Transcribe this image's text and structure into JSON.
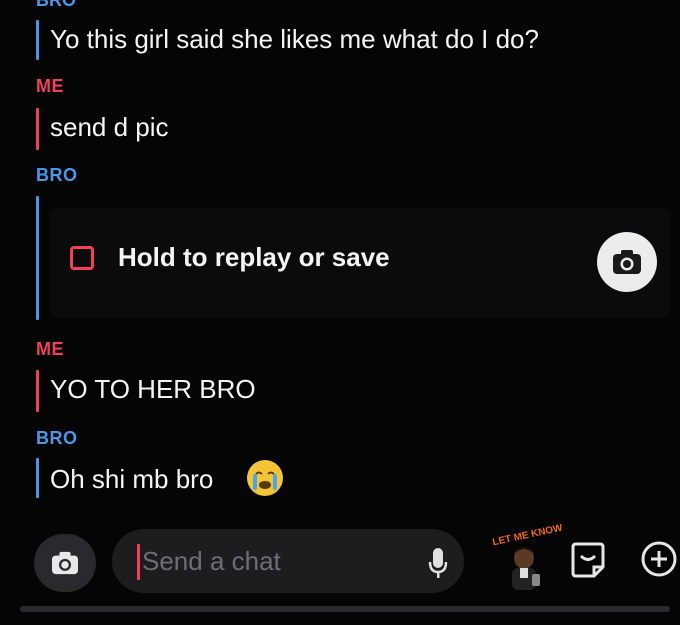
{
  "messages": [
    {
      "sender": "BRO",
      "text": "Yo this girl said she likes me what do I do?"
    },
    {
      "sender": "ME",
      "text": "send d pic"
    },
    {
      "sender": "BRO",
      "snap_label": "Hold to replay or save"
    },
    {
      "sender": "ME",
      "text": "YO TO HER BRO"
    },
    {
      "sender": "BRO",
      "text": "Oh shi mb bro"
    }
  ],
  "last_message_emoji": "😭",
  "composer": {
    "placeholder": "Send a chat",
    "bitmoji_text": "LET ME KNOW"
  },
  "colors": {
    "me": "#f0415a",
    "bro": "#4c98e6",
    "background": "#050506"
  },
  "icons": [
    "camera-icon",
    "microphone-icon",
    "sticker-icon",
    "plus-icon"
  ]
}
